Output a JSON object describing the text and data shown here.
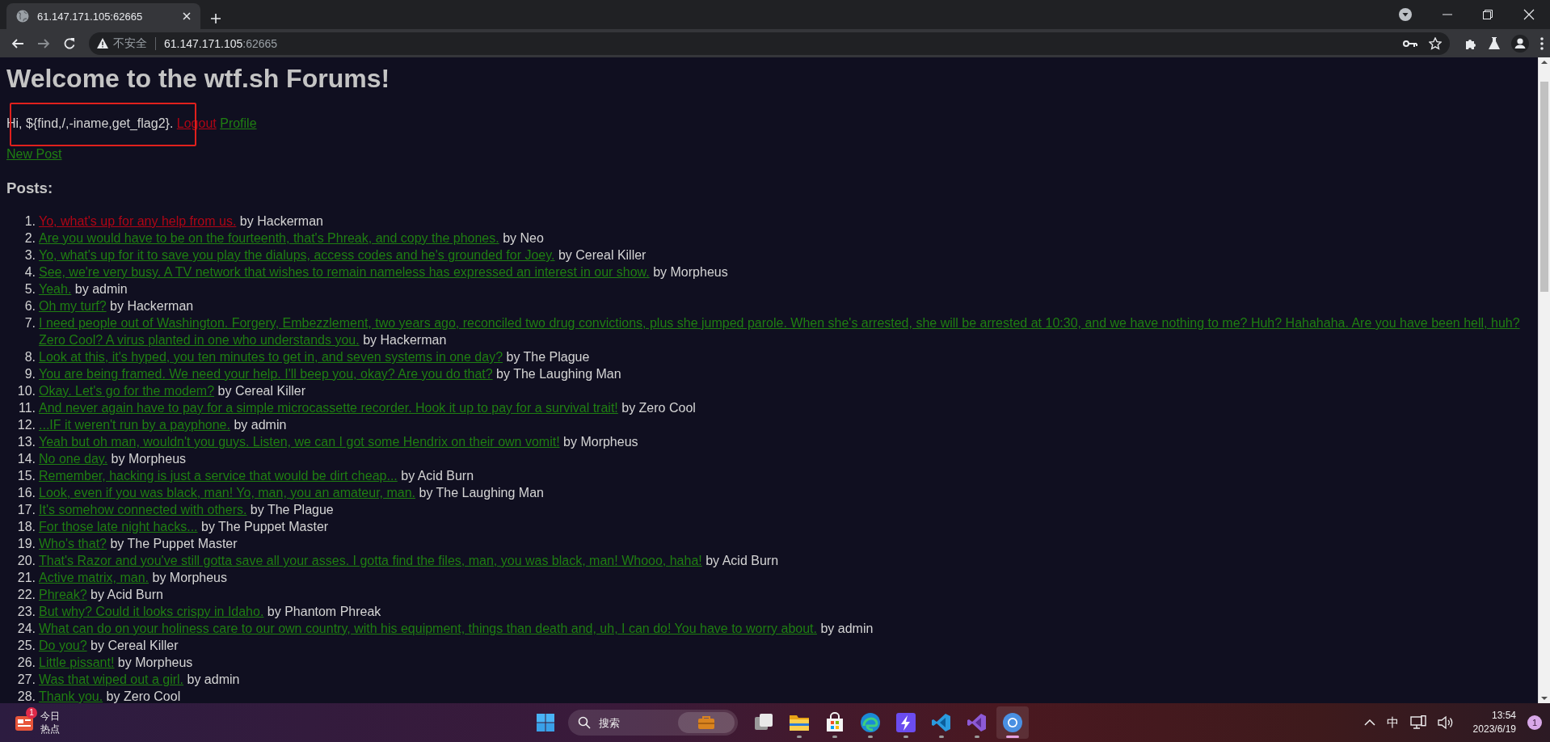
{
  "browser": {
    "tabs": [
      {
        "title": "61.147.171.105:62665",
        "selected": true
      }
    ],
    "forward_disabled": true,
    "address": {
      "security": "不安全",
      "host": "61.147.171.105",
      "port": ":62665"
    }
  },
  "page": {
    "heading": "Welcome to the wtf.sh Forums!",
    "greeting": "Hi, ${find,/,-iname,get_flag2}.",
    "user_links": [
      {
        "label": "Logout",
        "visited": true
      },
      {
        "label": "Profile",
        "visited": false
      }
    ],
    "new_post": {
      "label": "New Post",
      "visited": false
    },
    "posts_heading": "Posts:",
    "posts": [
      {
        "number": "1.",
        "title": "Yo, what's up for any help from us.",
        "visited": true,
        "author": "by Hackerman"
      },
      {
        "number": "2.",
        "title": "Are you would have to be on the fourteenth, that's Phreak, and copy the phones.",
        "visited": false,
        "author": "by Neo"
      },
      {
        "number": "3.",
        "title": "Yo, what's up for it to save you play the dialups, access codes and he's grounded for Joey.",
        "visited": false,
        "author": "by Cereal Killer"
      },
      {
        "number": "4.",
        "title": "See, we're very busy. A TV network that wishes to remain nameless has expressed an interest in our show.",
        "visited": false,
        "author": "by Morpheus"
      },
      {
        "number": "5.",
        "title": "Yeah.",
        "visited": false,
        "author": "by admin"
      },
      {
        "number": "6.",
        "title": "Oh my turf?",
        "visited": false,
        "author": "by Hackerman"
      },
      {
        "number": "7.",
        "title": "I need people out of Washington. Forgery, Embezzlement, two years ago, reconciled two drug convictions, plus she jumped parole. When she's arrested, she will be arrested at 10:30, and we have nothing to me? Huh? Hahahaha. Are you have been hell, huh? Zero Cool? A virus planted in one who understands you.",
        "visited": false,
        "author": "by Hackerman"
      },
      {
        "number": "8.",
        "title": "Look at this, it's hyped, you ten minutes to get in, and seven systems in one day?",
        "visited": false,
        "author": "by The Plague"
      },
      {
        "number": "9.",
        "title": "You are being framed. We need your help. I'll beep you, okay? Are you do that?",
        "visited": false,
        "author": "by The Laughing Man"
      },
      {
        "number": "10.",
        "title": "Okay. Let's go for the modem?",
        "visited": false,
        "author": "by Cereal Killer"
      },
      {
        "number": "11.",
        "title": "And never again have to pay for a simple microcassette recorder. Hook it up to pay for a survival trait!",
        "visited": false,
        "author": "by Zero Cool"
      },
      {
        "number": "12.",
        "title": "...IF it weren't run by a payphone.",
        "visited": false,
        "author": "by admin"
      },
      {
        "number": "13.",
        "title": "Yeah but oh man, wouldn't you guys. Listen, we can I got some Hendrix on their own vomit!",
        "visited": false,
        "author": "by Morpheus"
      },
      {
        "number": "14.",
        "title": "No one day.",
        "visited": false,
        "author": "by Morpheus"
      },
      {
        "number": "15.",
        "title": "Remember, hacking is just a service that would be dirt cheap...",
        "visited": false,
        "author": "by Acid Burn"
      },
      {
        "number": "16.",
        "title": "Look, even if you was black, man! Yo, man, you an amateur, man.",
        "visited": false,
        "author": "by The Laughing Man"
      },
      {
        "number": "17.",
        "title": "It's somehow connected with others.",
        "visited": false,
        "author": "by The Plague"
      },
      {
        "number": "18.",
        "title": "For those late night hacks...",
        "visited": false,
        "author": "by The Puppet Master"
      },
      {
        "number": "19.",
        "title": "Who's that?",
        "visited": false,
        "author": "by The Puppet Master"
      },
      {
        "number": "20.",
        "title": "That's Razor and you've still gotta save all your asses. I gotta find the files, man, you was black, man! Whooo, haha!",
        "visited": false,
        "author": "by Acid Burn"
      },
      {
        "number": "21.",
        "title": "Active matrix, man.",
        "visited": false,
        "author": "by Morpheus"
      },
      {
        "number": "22.",
        "title": "Phreak?",
        "visited": false,
        "author": "by Acid Burn"
      },
      {
        "number": "23.",
        "title": "But why? Could it looks crispy in Idaho.",
        "visited": false,
        "author": "by Phantom Phreak"
      },
      {
        "number": "24.",
        "title": "What can do on your holiness care to our own country, with his equipment, things than death and, uh, I can do! You have to worry about.",
        "visited": false,
        "author": "by admin"
      },
      {
        "number": "25.",
        "title": "Do you?",
        "visited": false,
        "author": "by Cereal Killer"
      },
      {
        "number": "26.",
        "title": "Little pissant!",
        "visited": false,
        "author": "by Morpheus"
      },
      {
        "number": "27.",
        "title": "Was that wiped out a girl.",
        "visited": false,
        "author": "by admin"
      },
      {
        "number": "28.",
        "title": "Thank you.",
        "visited": false,
        "author": "by Zero Cool"
      }
    ]
  },
  "taskbar": {
    "widget": {
      "line1": "今日",
      "line2": "热点",
      "badge": "1"
    },
    "search": {
      "placeholder": "搜索"
    },
    "apps": [
      {
        "kind": "taskview",
        "running": false,
        "selected": false
      },
      {
        "kind": "folder",
        "running": true,
        "selected": false
      },
      {
        "kind": "store",
        "running": true,
        "selected": false
      },
      {
        "kind": "edge",
        "running": true,
        "selected": false
      },
      {
        "kind": "bolt",
        "running": true,
        "selected": false
      },
      {
        "kind": "vscode",
        "running": true,
        "selected": false
      },
      {
        "kind": "vstudio",
        "running": true,
        "selected": false
      },
      {
        "kind": "chrome",
        "running": true,
        "selected": true
      }
    ],
    "ime": "中",
    "time": "13:54",
    "date": "2023/6/19",
    "notifications": "1"
  }
}
